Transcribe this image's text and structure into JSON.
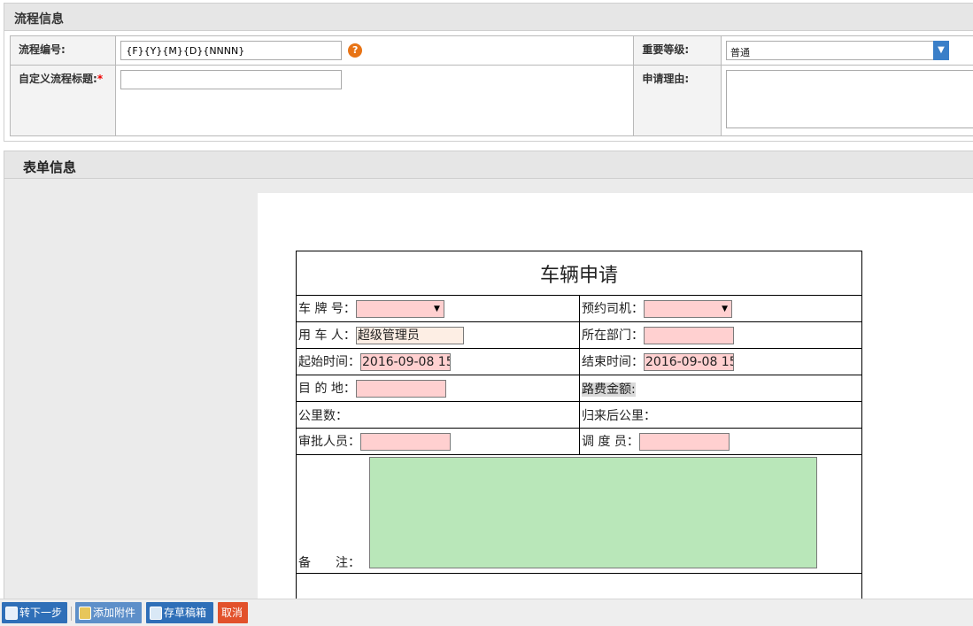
{
  "process_section": {
    "title": "流程信息",
    "number_label": "流程编号:",
    "number_value": "{F}{Y}{M}{D}{NNNN}",
    "help_glyph": "?",
    "priority_label": "重要等级:",
    "priority_value": "普通",
    "custom_title_label": "自定义流程标题:",
    "required_mark": "*",
    "custom_title_value": "",
    "reason_label": "申请理由:",
    "reason_value": ""
  },
  "form_section": {
    "title": "表单信息"
  },
  "vehicle_form": {
    "title": "车辆申请",
    "plate_label": "车 牌 号：",
    "driver_label": "预约司机：",
    "user_label": "用 车 人：",
    "user_value": "超级管理员",
    "dept_label": "所在部门：",
    "start_label": "起始时间：",
    "start_value": "2016-09-08 15",
    "end_label": "结束时间：",
    "end_value": "2016-09-08 15",
    "dest_label": "目 的 地：",
    "fee_label": "路费金额:",
    "km_label": "公里数：",
    "return_km_label": "归来后公里：",
    "approver_label": "审批人员：",
    "dispatcher_label": "调 度 员：",
    "memo_label": "备　　注："
  },
  "toolbar": {
    "next_label": "转下一步",
    "attach_label": "添加附件",
    "draft_label": "存草稿箱",
    "cancel_label": "取消"
  },
  "colors": {
    "required_field": "#ffd0d0",
    "memo_field": "#b9e7b9",
    "primary_button": "#2f6fb8",
    "cancel_button": "#e2512b",
    "help_icon": "#e87416"
  }
}
